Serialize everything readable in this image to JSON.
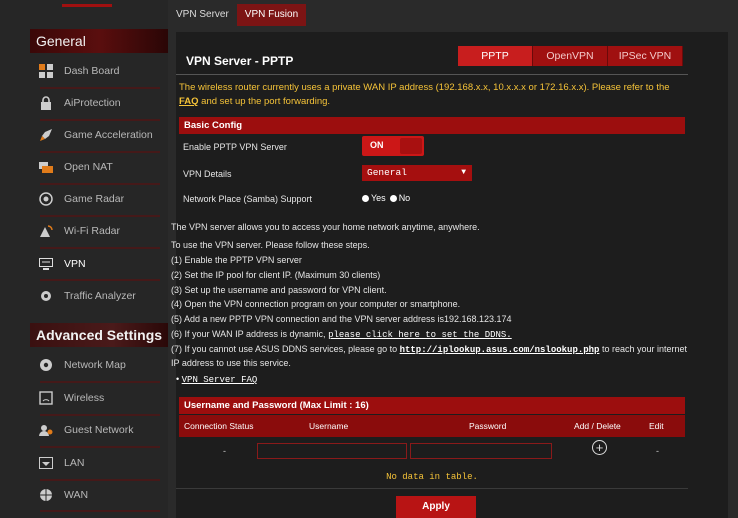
{
  "sidebar": {
    "general_title": "General",
    "advanced_title": "Advanced Settings",
    "items": [
      {
        "label": "Dash Board",
        "icon": "dashboard-icon"
      },
      {
        "label": "AiProtection",
        "icon": "lock-icon"
      },
      {
        "label": "Game Acceleration",
        "icon": "rocket-icon"
      },
      {
        "label": "Open NAT",
        "icon": "open-nat-icon"
      },
      {
        "label": "Game Radar",
        "icon": "radar-icon"
      },
      {
        "label": "Wi-Fi Radar",
        "icon": "wifi-radar-icon"
      },
      {
        "label": "VPN",
        "icon": "vpn-icon"
      },
      {
        "label": "Traffic Analyzer",
        "icon": "traffic-icon"
      }
    ],
    "advanced_items": [
      {
        "label": "Network Map",
        "icon": "network-map-icon"
      },
      {
        "label": "Wireless",
        "icon": "wireless-icon"
      },
      {
        "label": "Guest Network",
        "icon": "guest-network-icon"
      },
      {
        "label": "LAN",
        "icon": "lan-icon"
      },
      {
        "label": "WAN",
        "icon": "globe-icon"
      }
    ]
  },
  "tabs": [
    "VPN Server",
    "VPN Fusion"
  ],
  "page_title": "VPN Server - PPTP",
  "protocols": [
    "PPTP",
    "OpenVPN",
    "IPSec VPN"
  ],
  "notice": {
    "text": "The wireless router currently uses a private WAN IP address (192.168.x.x, 10.x.x.x or 172.16.x.x). Please refer to the ",
    "link": "FAQ",
    "text2": " and set up the port forwarding."
  },
  "basic_config": {
    "title": "Basic Config",
    "enable_label": "Enable PPTP VPN Server",
    "toggle_value": "ON",
    "details_label": "VPN Details",
    "details_value": "General",
    "samba_label": "Network Place (Samba) Support",
    "yes": "Yes",
    "no": "No"
  },
  "instructions": {
    "intro": "The VPN server allows you to access your home network anytime, anywhere.",
    "steps_intro": "To use the VPN server. Please follow these steps.",
    "s1": "(1) Enable the PPTP VPN server",
    "s2": "(2) Set the IP pool for client IP. (Maximum 30 clients)",
    "s3": "(3) Set up the username and password for VPN client.",
    "s4": "(4) Open the VPN connection program on your computer or smartphone.",
    "s5": "(5) Add a new PPTP VPN connection and the VPN server address is192.168.123.174",
    "s6_prefix": "(6) If your WAN IP address is dynamic, ",
    "s6_link": "please click here to set the DDNS.",
    "s7_prefix": "(7) If you cannot use ASUS DDNS services, please go to ",
    "s7_link": "http://iplookup.asus.com/nslookup.php",
    "s7_suffix": " to reach your internet",
    "s7_line2": "IP address to use this service.",
    "faq_link": "VPN Server FAQ"
  },
  "table": {
    "title": "Username and Password (Max Limit : 16)",
    "headers": [
      "Connection Status",
      "Username",
      "Password",
      "Add / Delete",
      "Edit"
    ],
    "dash": "-",
    "empty": "No data in table."
  },
  "apply_label": "Apply",
  "colors": {
    "accent": "#b81414",
    "warning": "#f5c338",
    "bg": "#1d1d1d"
  }
}
